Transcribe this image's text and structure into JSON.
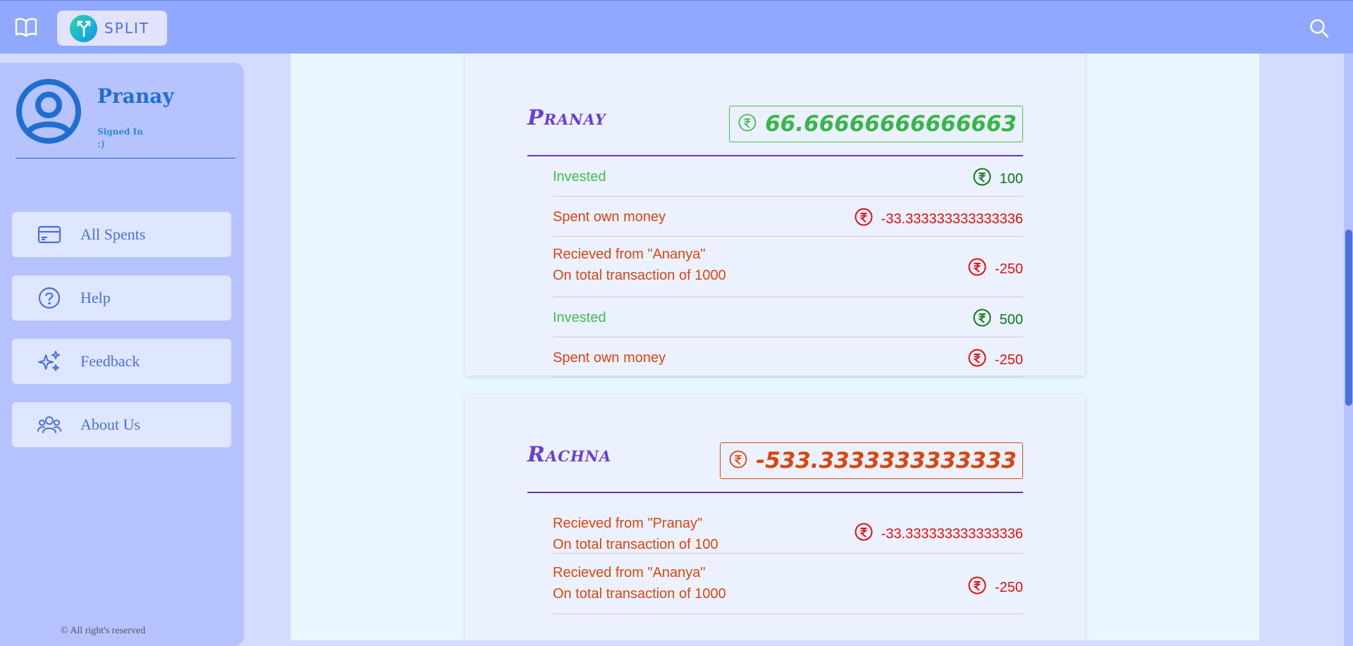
{
  "header": {
    "app_name": "SPLIT",
    "icons": {
      "menu": "book-open-icon",
      "logo": "split-arrows-icon",
      "search": "search-icon"
    }
  },
  "sidebar": {
    "profile": {
      "name": "Pranay",
      "status": "Signed In",
      "note": ":)"
    },
    "items": [
      {
        "label": "All Spents",
        "icon": "credit-card-icon"
      },
      {
        "label": "Help",
        "icon": "question-circle-icon"
      },
      {
        "label": "Feedback",
        "icon": "sparkles-icon"
      },
      {
        "label": "About Us",
        "icon": "users-icon"
      }
    ],
    "copyright": "© All right's reserved"
  },
  "cards": [
    {
      "name": "Pranay",
      "total": "66.66666666666663",
      "total_sign": "positive",
      "transactions": [
        {
          "line1": "Invested",
          "line2": "",
          "amount": "100",
          "kind": "green"
        },
        {
          "line1": "Spent own money",
          "line2": "",
          "amount": "-33.333333333333336",
          "kind": "red"
        },
        {
          "line1": "Recieved from \"Ananya\"",
          "line2": "On total transaction of 1000",
          "amount": "-250",
          "kind": "red"
        },
        {
          "line1": "Invested",
          "line2": "",
          "amount": "500",
          "kind": "green"
        },
        {
          "line1": "Spent own money",
          "line2": "",
          "amount": "-250",
          "kind": "red"
        }
      ]
    },
    {
      "name": "Rachna",
      "total": "-533.3333333333333",
      "total_sign": "negative",
      "transactions": [
        {
          "line1": "Recieved from \"Pranay\"",
          "line2": "On total transaction of 100",
          "amount": "-33.333333333333336",
          "kind": "red"
        },
        {
          "line1": "Recieved from \"Ananya\"",
          "line2": "On total transaction of 1000",
          "amount": "-250",
          "kind": "red"
        }
      ]
    }
  ],
  "colors": {
    "topbar": "#91a8ff",
    "sidebar": "#b6c3ff",
    "accent": "#4a6fe0",
    "positive": "#3fbf4f",
    "negative": "#d9460f",
    "name_purple": "#6a3fd0"
  }
}
